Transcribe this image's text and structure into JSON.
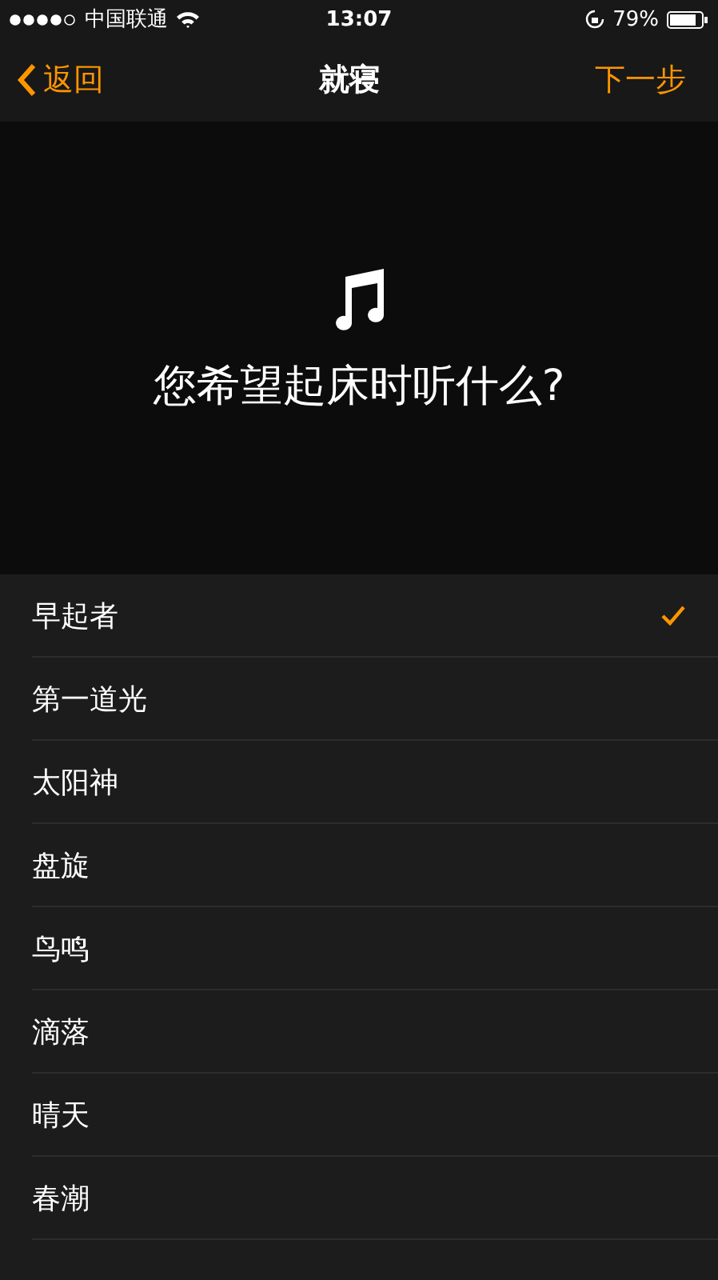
{
  "status_bar": {
    "carrier": "中国联通",
    "time": "13:07",
    "battery": "79%"
  },
  "nav": {
    "back": "返回",
    "title": "就寝",
    "next": "下一步"
  },
  "prompt": "您希望起床时听什么?",
  "sounds": [
    {
      "name": "早起者",
      "selected": true
    },
    {
      "name": "第一道光",
      "selected": false
    },
    {
      "name": "太阳神",
      "selected": false
    },
    {
      "name": "盘旋",
      "selected": false
    },
    {
      "name": "鸟鸣",
      "selected": false
    },
    {
      "name": "滴落",
      "selected": false
    },
    {
      "name": "晴天",
      "selected": false
    },
    {
      "name": "春潮",
      "selected": false
    }
  ]
}
